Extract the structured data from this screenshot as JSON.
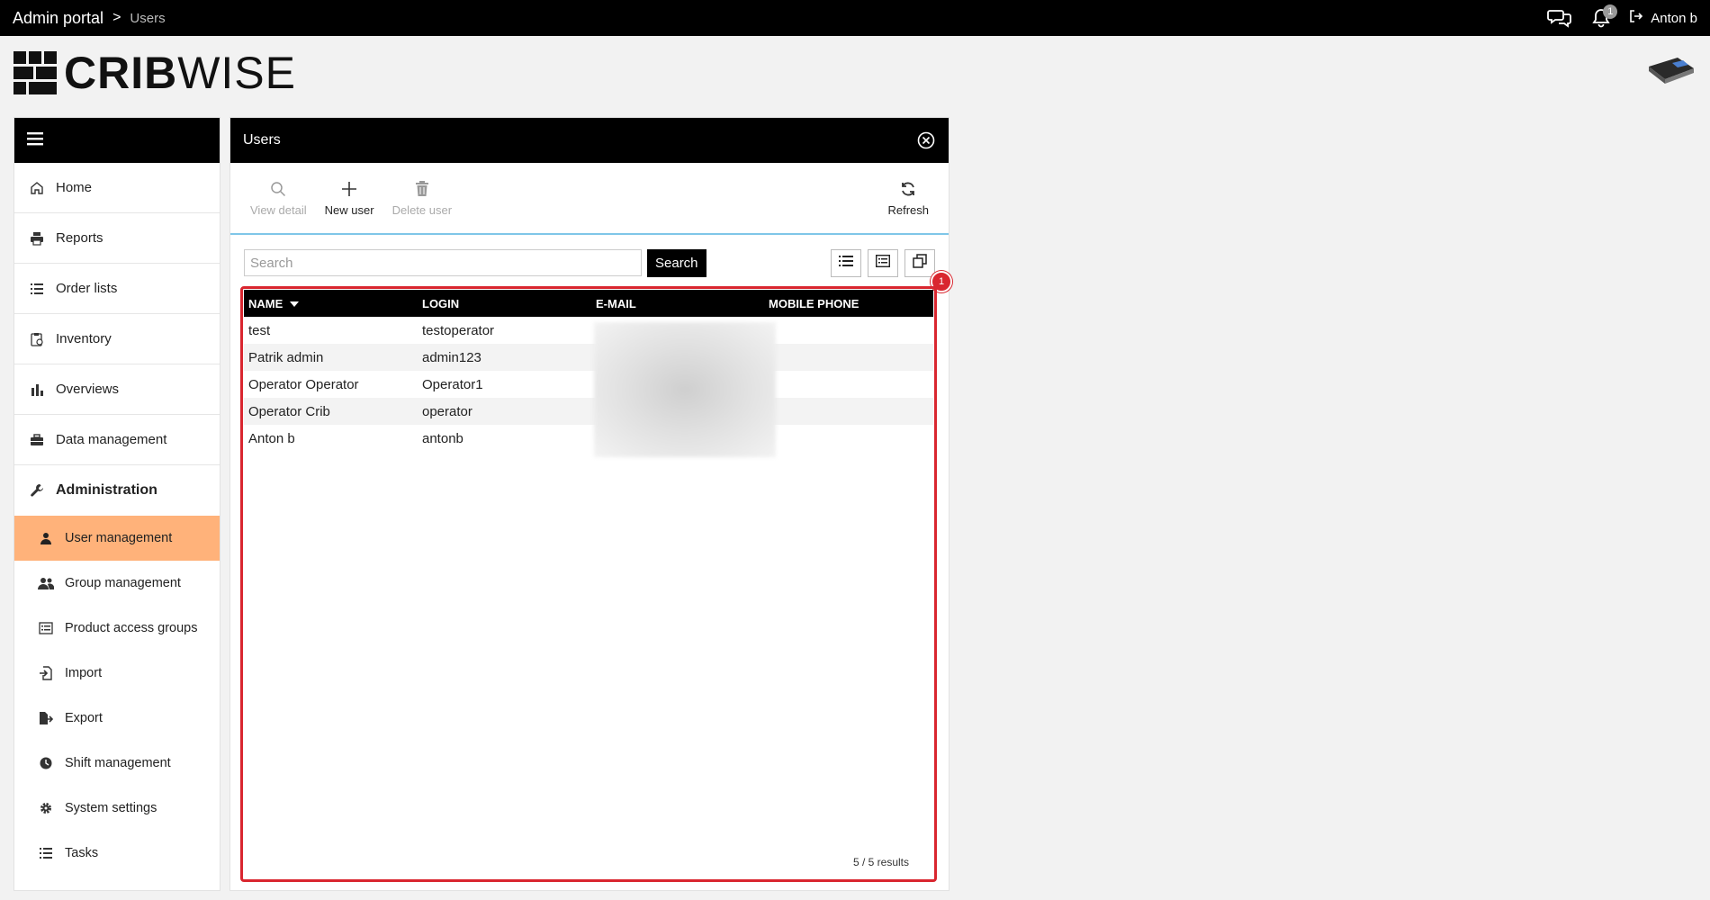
{
  "topbar": {
    "breadcrumb_root": "Admin portal",
    "breadcrumb_sep": ">",
    "breadcrumb_current": "Users",
    "notification_count": "1",
    "user_name": "Anton b"
  },
  "logo": {
    "text_bold": "CRIB",
    "text_light": "WISE"
  },
  "sidebar": {
    "items": [
      {
        "label": "Home",
        "icon": "home-icon"
      },
      {
        "label": "Reports",
        "icon": "printer-icon"
      },
      {
        "label": "Order lists",
        "icon": "list-icon"
      },
      {
        "label": "Inventory",
        "icon": "clipboard-icon"
      },
      {
        "label": "Overviews",
        "icon": "bar-chart-icon"
      },
      {
        "label": "Data management",
        "icon": "briefcase-icon"
      },
      {
        "label": "Administration",
        "icon": "wrench-icon"
      }
    ],
    "subitems": [
      {
        "label": "User management",
        "icon": "user-icon",
        "active": true
      },
      {
        "label": "Group management",
        "icon": "users-icon"
      },
      {
        "label": "Product access groups",
        "icon": "list-box-icon"
      },
      {
        "label": "Import",
        "icon": "import-icon"
      },
      {
        "label": "Export",
        "icon": "export-icon"
      },
      {
        "label": "Shift management",
        "icon": "clock-icon"
      },
      {
        "label": "System settings",
        "icon": "gear-icon"
      },
      {
        "label": "Tasks",
        "icon": "tasks-icon"
      }
    ]
  },
  "panel": {
    "title": "Users",
    "toolbar": {
      "view_detail": "View detail",
      "new_user": "New user",
      "delete_user": "Delete user",
      "refresh": "Refresh"
    },
    "search": {
      "placeholder": "Search",
      "button": "Search"
    },
    "grid_badge": "1",
    "table": {
      "columns": [
        "NAME",
        "LOGIN",
        "E-MAIL",
        "MOBILE PHONE"
      ],
      "rows": [
        {
          "name": "test",
          "login": "testoperator"
        },
        {
          "name": "Patrik admin",
          "login": "admin123"
        },
        {
          "name": "Operator Operator",
          "login": "Operator1"
        },
        {
          "name": "Operator Crib",
          "login": "operator"
        },
        {
          "name": "Anton b",
          "login": "antonb"
        }
      ]
    },
    "results": "5 / 5 results"
  },
  "colors": {
    "accent": "#ffb27a",
    "highlight": "#d9262f",
    "divider": "#7fc6e8"
  }
}
